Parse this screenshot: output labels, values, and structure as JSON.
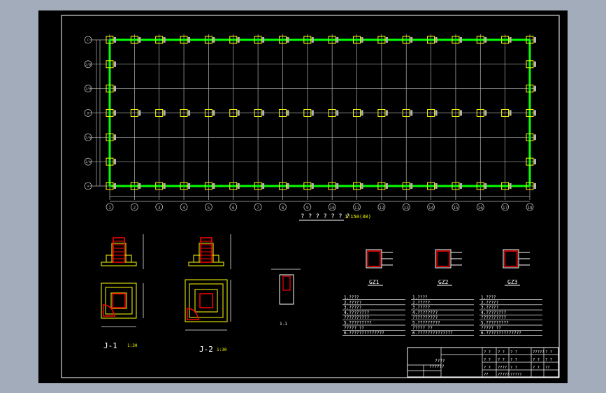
{
  "colors": {
    "viewer_background": "#a3acbb",
    "drawing_background": "#000000",
    "grid_lines": "#b4b4b4",
    "beams": "#00ff00",
    "columns": "#ffff00",
    "rebar": "#ff0000",
    "annotation": "#00ffff",
    "frame": "#ffffff"
  },
  "plan": {
    "title": "? ? ? ? ? ? ?",
    "scale": "1:150(30)",
    "column_axes": [
      "1",
      "2",
      "3",
      "4",
      "5",
      "6",
      "7",
      "8",
      "9",
      "10",
      "11",
      "12",
      "13",
      "14",
      "15",
      "16",
      "17",
      "18"
    ],
    "row_axes": [
      "C",
      "2/B",
      "1/B",
      "B",
      "2/A",
      "1/A",
      "A"
    ]
  },
  "details": {
    "j1": {
      "label": "J-1",
      "scale": "1:30"
    },
    "j2": {
      "label": "J-2",
      "scale": "1:30"
    },
    "section": {
      "label": "1-1"
    },
    "gz": [
      "GZ1",
      "GZ2",
      "GZ3"
    ]
  },
  "notes": [
    [
      "1.????",
      "2.?????",
      "3.?????",
      "4.????????",
      "   ??????????",
      "5.?????????",
      "   ?????  ??",
      "6.??????????????"
    ],
    [
      "1.????",
      "2.?????",
      "3.?????",
      "4.????????",
      "   ??????????",
      "5.?????????",
      "   ?????  ??",
      "6.??????????????"
    ],
    [
      "1.????",
      "2.?????",
      "3.?????",
      "4.????????",
      "   ??????????",
      "5.?????????",
      "   ?????  ??",
      "6.??????????????"
    ]
  ],
  "title_block": {
    "project": "????",
    "drawing": "??????",
    "cells": [
      "? ?",
      "? ?",
      "? ?",
      "?????",
      "? ?",
      "? ?",
      "? ?",
      "? ?",
      "? ?",
      "? ?",
      "? ?",
      "????",
      "? ?",
      "? ?",
      "??",
      "??",
      "?????",
      "?????"
    ]
  }
}
